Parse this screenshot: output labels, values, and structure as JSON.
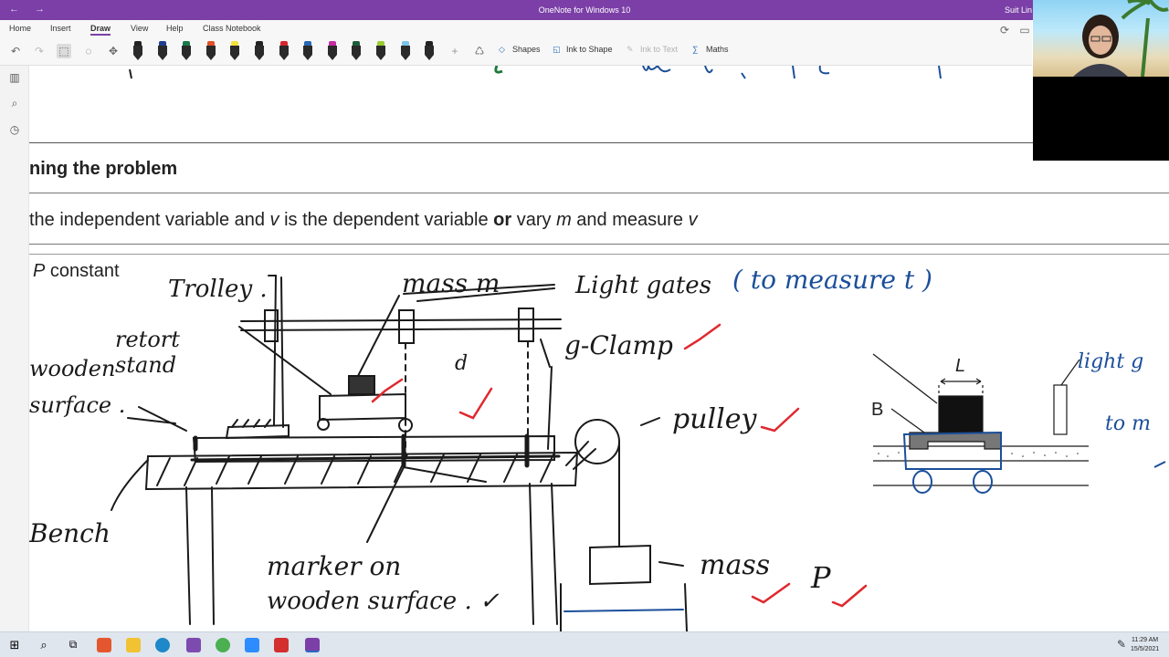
{
  "window": {
    "title": "OneNote for Windows 10",
    "user": "Suit Lin",
    "back_glyph": "←",
    "forward_glyph": "→"
  },
  "ribbon": {
    "tabs": [
      "Home",
      "Insert",
      "Draw",
      "View",
      "Help",
      "Class Notebook"
    ],
    "active_tab": "Draw",
    "buttons": {
      "shapes": "Shapes",
      "ink_to_shape": "Ink to Shape",
      "ink_to_text": "Ink to Text",
      "maths": "Maths"
    },
    "pen_colors": [
      "#222222",
      "#1f3f8f",
      "#1b7a4a",
      "#e1502a",
      "#f4e13a",
      "#222222",
      "#d8262e",
      "#2767b3",
      "#c52fa3",
      "#1b5e3a",
      "#9acd32",
      "#7fc3ea",
      "#222222"
    ]
  },
  "page": {
    "heading": "ning the problem",
    "line1_parts": {
      "a": "the independent variable and ",
      "b": "v",
      "c": " is the dependent variable ",
      "d": "or",
      "e": " vary ",
      "f": "m",
      "g": " and measure ",
      "h": "v"
    },
    "line2_parts": {
      "a": "P",
      "b": " constant"
    }
  },
  "ink": {
    "trolley": "Trolley .",
    "mass_m": "mass m",
    "light_gates": "Light gates",
    "to_measure_t": "( to measure t )",
    "retort_stand": "retort stand",
    "wooden_surface": "wooden surface .",
    "g_clamp": "g-Clamp",
    "d": "d",
    "pulley": "pulley",
    "bench": "Bench",
    "marker_line1": "marker on",
    "marker_line2": "wooden surface . ✓",
    "mass": "mass",
    "p": "P",
    "l": "L",
    "b": "B",
    "light_g": "light g",
    "to_m": "to m",
    "check": "✓"
  },
  "taskbar": {
    "time": "11:29 AM",
    "date": "15/5/2021"
  }
}
